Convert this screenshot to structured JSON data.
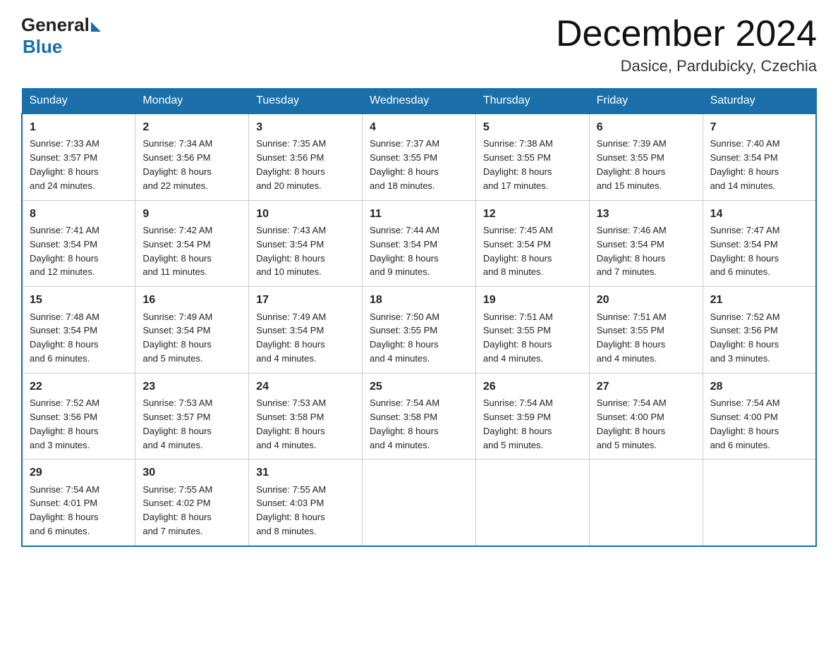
{
  "header": {
    "logo_general": "General",
    "logo_blue": "Blue",
    "month_title": "December 2024",
    "location": "Dasice, Pardubicky, Czechia"
  },
  "days_of_week": [
    "Sunday",
    "Monday",
    "Tuesday",
    "Wednesday",
    "Thursday",
    "Friday",
    "Saturday"
  ],
  "weeks": [
    [
      {
        "day": "1",
        "info": "Sunrise: 7:33 AM\nSunset: 3:57 PM\nDaylight: 8 hours\nand 24 minutes."
      },
      {
        "day": "2",
        "info": "Sunrise: 7:34 AM\nSunset: 3:56 PM\nDaylight: 8 hours\nand 22 minutes."
      },
      {
        "day": "3",
        "info": "Sunrise: 7:35 AM\nSunset: 3:56 PM\nDaylight: 8 hours\nand 20 minutes."
      },
      {
        "day": "4",
        "info": "Sunrise: 7:37 AM\nSunset: 3:55 PM\nDaylight: 8 hours\nand 18 minutes."
      },
      {
        "day": "5",
        "info": "Sunrise: 7:38 AM\nSunset: 3:55 PM\nDaylight: 8 hours\nand 17 minutes."
      },
      {
        "day": "6",
        "info": "Sunrise: 7:39 AM\nSunset: 3:55 PM\nDaylight: 8 hours\nand 15 minutes."
      },
      {
        "day": "7",
        "info": "Sunrise: 7:40 AM\nSunset: 3:54 PM\nDaylight: 8 hours\nand 14 minutes."
      }
    ],
    [
      {
        "day": "8",
        "info": "Sunrise: 7:41 AM\nSunset: 3:54 PM\nDaylight: 8 hours\nand 12 minutes."
      },
      {
        "day": "9",
        "info": "Sunrise: 7:42 AM\nSunset: 3:54 PM\nDaylight: 8 hours\nand 11 minutes."
      },
      {
        "day": "10",
        "info": "Sunrise: 7:43 AM\nSunset: 3:54 PM\nDaylight: 8 hours\nand 10 minutes."
      },
      {
        "day": "11",
        "info": "Sunrise: 7:44 AM\nSunset: 3:54 PM\nDaylight: 8 hours\nand 9 minutes."
      },
      {
        "day": "12",
        "info": "Sunrise: 7:45 AM\nSunset: 3:54 PM\nDaylight: 8 hours\nand 8 minutes."
      },
      {
        "day": "13",
        "info": "Sunrise: 7:46 AM\nSunset: 3:54 PM\nDaylight: 8 hours\nand 7 minutes."
      },
      {
        "day": "14",
        "info": "Sunrise: 7:47 AM\nSunset: 3:54 PM\nDaylight: 8 hours\nand 6 minutes."
      }
    ],
    [
      {
        "day": "15",
        "info": "Sunrise: 7:48 AM\nSunset: 3:54 PM\nDaylight: 8 hours\nand 6 minutes."
      },
      {
        "day": "16",
        "info": "Sunrise: 7:49 AM\nSunset: 3:54 PM\nDaylight: 8 hours\nand 5 minutes."
      },
      {
        "day": "17",
        "info": "Sunrise: 7:49 AM\nSunset: 3:54 PM\nDaylight: 8 hours\nand 4 minutes."
      },
      {
        "day": "18",
        "info": "Sunrise: 7:50 AM\nSunset: 3:55 PM\nDaylight: 8 hours\nand 4 minutes."
      },
      {
        "day": "19",
        "info": "Sunrise: 7:51 AM\nSunset: 3:55 PM\nDaylight: 8 hours\nand 4 minutes."
      },
      {
        "day": "20",
        "info": "Sunrise: 7:51 AM\nSunset: 3:55 PM\nDaylight: 8 hours\nand 4 minutes."
      },
      {
        "day": "21",
        "info": "Sunrise: 7:52 AM\nSunset: 3:56 PM\nDaylight: 8 hours\nand 3 minutes."
      }
    ],
    [
      {
        "day": "22",
        "info": "Sunrise: 7:52 AM\nSunset: 3:56 PM\nDaylight: 8 hours\nand 3 minutes."
      },
      {
        "day": "23",
        "info": "Sunrise: 7:53 AM\nSunset: 3:57 PM\nDaylight: 8 hours\nand 4 minutes."
      },
      {
        "day": "24",
        "info": "Sunrise: 7:53 AM\nSunset: 3:58 PM\nDaylight: 8 hours\nand 4 minutes."
      },
      {
        "day": "25",
        "info": "Sunrise: 7:54 AM\nSunset: 3:58 PM\nDaylight: 8 hours\nand 4 minutes."
      },
      {
        "day": "26",
        "info": "Sunrise: 7:54 AM\nSunset: 3:59 PM\nDaylight: 8 hours\nand 5 minutes."
      },
      {
        "day": "27",
        "info": "Sunrise: 7:54 AM\nSunset: 4:00 PM\nDaylight: 8 hours\nand 5 minutes."
      },
      {
        "day": "28",
        "info": "Sunrise: 7:54 AM\nSunset: 4:00 PM\nDaylight: 8 hours\nand 6 minutes."
      }
    ],
    [
      {
        "day": "29",
        "info": "Sunrise: 7:54 AM\nSunset: 4:01 PM\nDaylight: 8 hours\nand 6 minutes."
      },
      {
        "day": "30",
        "info": "Sunrise: 7:55 AM\nSunset: 4:02 PM\nDaylight: 8 hours\nand 7 minutes."
      },
      {
        "day": "31",
        "info": "Sunrise: 7:55 AM\nSunset: 4:03 PM\nDaylight: 8 hours\nand 8 minutes."
      },
      {
        "day": "",
        "info": ""
      },
      {
        "day": "",
        "info": ""
      },
      {
        "day": "",
        "info": ""
      },
      {
        "day": "",
        "info": ""
      }
    ]
  ]
}
